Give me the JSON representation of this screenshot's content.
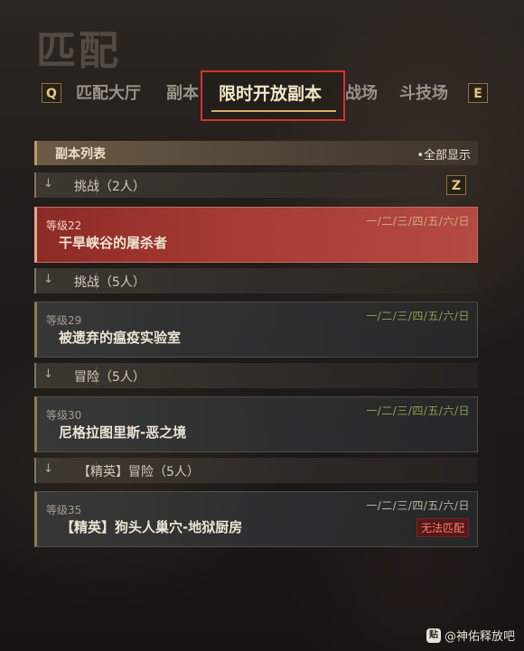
{
  "window_title": "匹配",
  "tabs": {
    "left_key": "Q",
    "right_key": "E",
    "items": [
      {
        "label": "匹配大厅"
      },
      {
        "label": "副本"
      },
      {
        "label": "限时开放副本"
      },
      {
        "label": "战场"
      },
      {
        "label": "斗技场"
      }
    ]
  },
  "list": {
    "header": "副本列表",
    "show_all": "•全部显示"
  },
  "groups": [
    {
      "label": "挑战（2人）",
      "key": "Z"
    },
    {
      "label": "挑战（5人）"
    },
    {
      "label": "冒险（5人）"
    },
    {
      "label": "【精英】冒险（5人）"
    }
  ],
  "cards": [
    {
      "level": "等级22",
      "name": "干旱峡谷的屠杀者",
      "days": "一/二/三/四/五/六/日"
    },
    {
      "level": "等级29",
      "name": "被遗弃的瘟疫实验室",
      "days": "一/二/三/四/五/六/日"
    },
    {
      "level": "等级30",
      "name": "尼格拉图里斯-恶之境",
      "days": "一/二/三/四/五/六/日"
    },
    {
      "level": "等级35",
      "name": "【精英】狗头人巢穴-地狱厨房",
      "days": "一/二/三/四/五/六/日",
      "badge": "无法匹配"
    }
  ],
  "watermark": "@神佑释放吧",
  "colors": {
    "accent_gold": "#d7b26a",
    "highlight_red": "#d73030",
    "selected_card": "#a63b34",
    "days_green": "#8aa04f"
  }
}
